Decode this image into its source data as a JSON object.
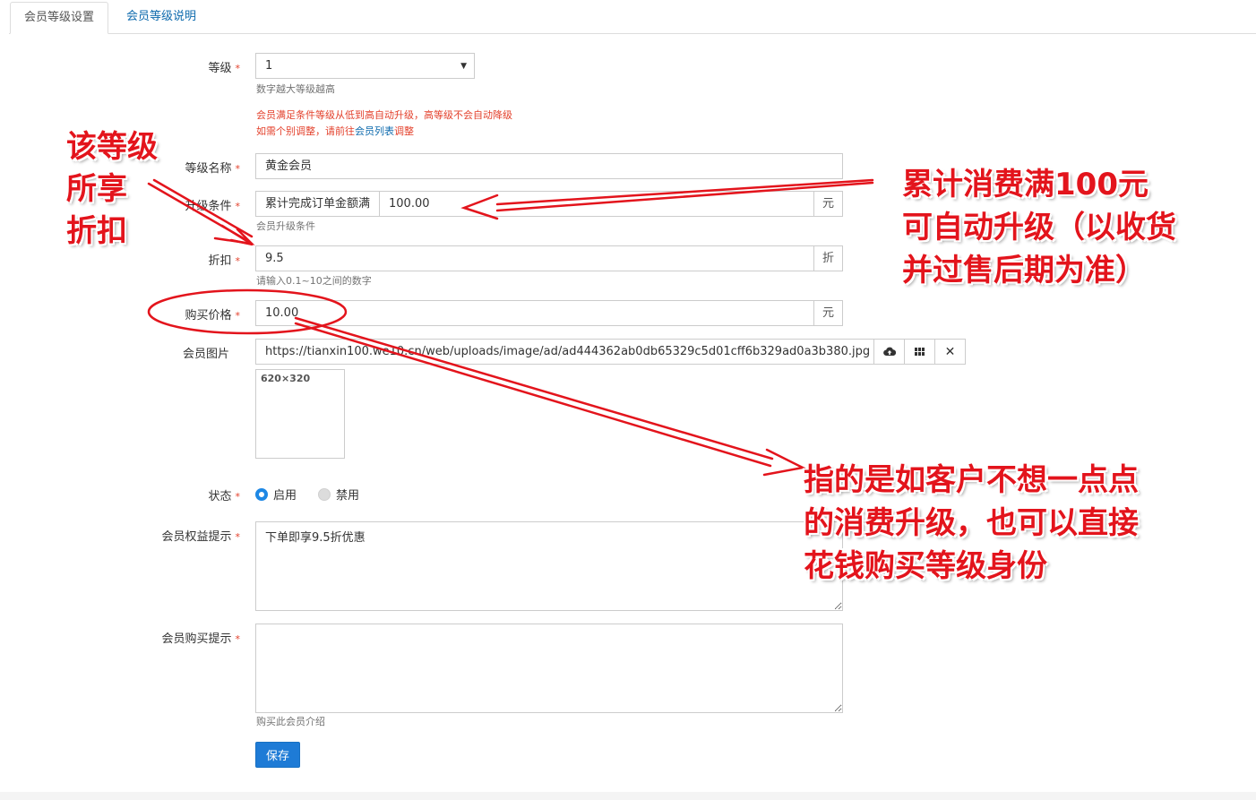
{
  "tabs": [
    {
      "label": "会员等级设置",
      "active": true
    },
    {
      "label": "会员等级说明",
      "active": false
    }
  ],
  "required_mark": "*",
  "form": {
    "level": {
      "label": "等级",
      "value": "1",
      "help": "数字越大等级越高"
    },
    "level_warning": {
      "line1": "会员满足条件等级从低到高自动升级，高等级不会自动降级",
      "line2_before": "如需个别调整，请前往",
      "line2_link": "会员列表",
      "line2_after": "调整"
    },
    "level_name": {
      "label": "等级名称",
      "value": "黄金会员"
    },
    "upgrade_condition": {
      "label": "升级条件",
      "type": "累计完成订单金额满",
      "value": "100.00",
      "unit": "元",
      "help": "会员升级条件"
    },
    "discount": {
      "label": "折扣",
      "value": "9.5",
      "unit": "折",
      "help": "请输入0.1~10之间的数字"
    },
    "price": {
      "label": "购买价格",
      "value": "10.00",
      "unit": "元"
    },
    "image": {
      "label": "会员图片",
      "value": "https://tianxin100.we10.cn/web/uploads/image/ad/ad444362ab0db65329c5d01cff6b329ad0a3b380.jpg",
      "thumb_text": "620×320"
    },
    "status": {
      "label": "状态",
      "options": [
        "启用",
        "禁用"
      ],
      "selected": "启用"
    },
    "benefit_tip": {
      "label": "会员权益提示",
      "value": "下单即享9.5折优惠"
    },
    "purchase_tip": {
      "label": "会员购买提示",
      "value": "",
      "help": "购买此会员介绍"
    },
    "save_label": "保存"
  },
  "annotations": {
    "discount_note": [
      "该等级",
      "所享",
      "折扣"
    ],
    "upgrade_note": [
      "累计消费满100元",
      "可自动升级（以收货",
      "并过售后期为准）"
    ],
    "price_note": [
      "指的是如客户不想一点点",
      "的消费升级，也可以直接",
      "花钱购买等级身份"
    ],
    "color": "#e3141c"
  },
  "colors": {
    "accent": "#1e7bd6",
    "link": "#0d6aad",
    "warning": "#e3412c"
  },
  "icons": {
    "upload": "cloud-upload-icon",
    "gallery": "grid-icon",
    "clear": "close-icon"
  }
}
